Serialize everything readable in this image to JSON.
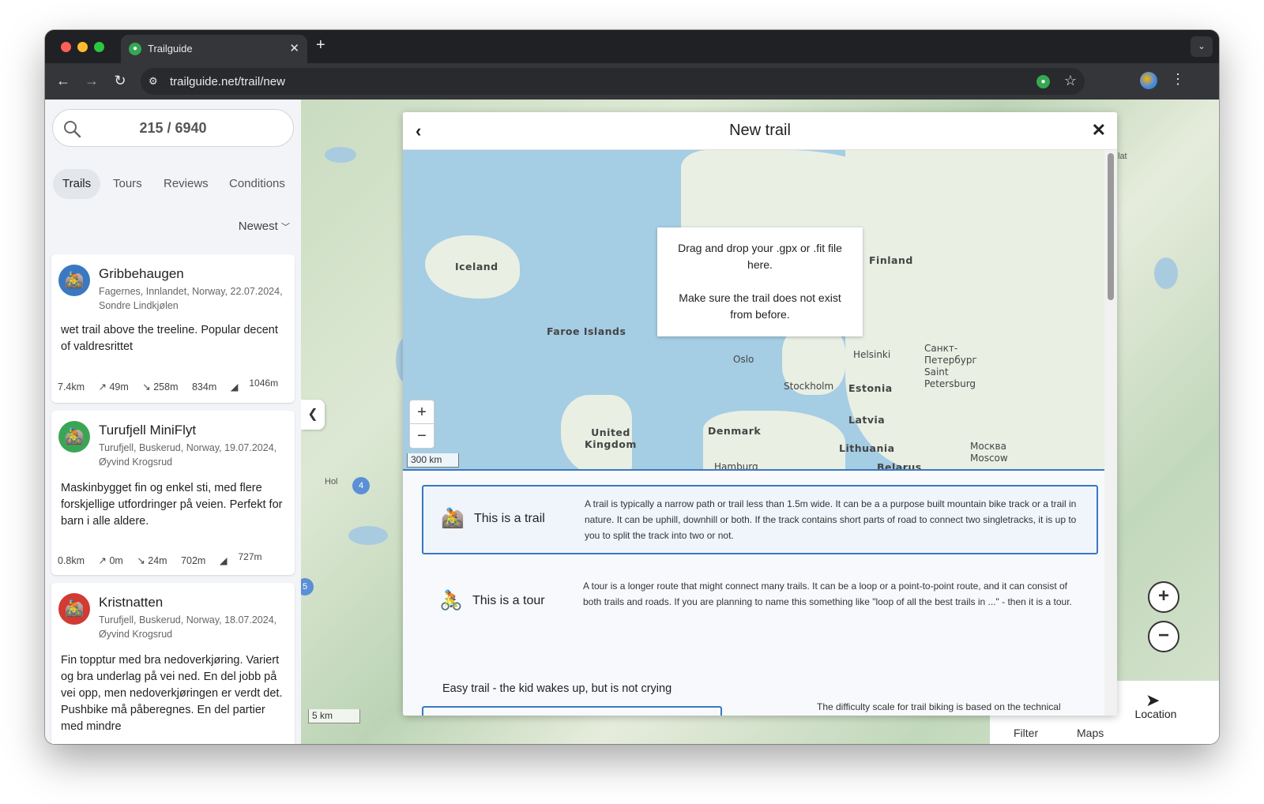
{
  "browser": {
    "tab_title": "Trailguide",
    "tab_close": "✕",
    "new_tab": "+",
    "url": "trailguide.net/trail/new"
  },
  "sidebar": {
    "search_count": "215 / 6940",
    "tabs": [
      {
        "label": "Trails",
        "active": true
      },
      {
        "label": "Tours",
        "active": false
      },
      {
        "label": "Reviews",
        "active": false
      },
      {
        "label": "Conditions",
        "active": false
      }
    ],
    "sort_label": "Newest",
    "cards": [
      {
        "title": "Gribbehaugen",
        "meta": "Fagernes, Innlandet, Norway, 22.07.2024, Sondre Lindkjølen",
        "desc": "wet trail above the treeline. Popular decent of valdresrittet",
        "distance": "7.4km",
        "climb": "↗ 49m",
        "descent": "↘ 258m",
        "min_alt": "834m",
        "max_alt": "1046m",
        "avatar_color": "#3a78c2"
      },
      {
        "title": "Turufjell MiniFlyt",
        "meta": "Turufjell, Buskerud, Norway, 19.07.2024, Øyvind Krogsrud",
        "desc": "Maskinbygget fin og enkel sti, med flere forskjellige utfordringer på veien. Perfekt for barn i alle aldere.",
        "distance": "0.8km",
        "climb": "↗ 0m",
        "descent": "↘ 24m",
        "min_alt": "702m",
        "max_alt": "727m",
        "avatar_color": "#3aa655"
      },
      {
        "title": "Kristnatten",
        "meta": "Turufjell, Buskerud, Norway, 18.07.2024, Øyvind Krogsrud",
        "desc": "Fin topptur med bra nedoverkjøring. Variert og bra underlag på vei ned. En del jobb på vei opp, men nedoverkjøringen er verdt det. Pushbike må påberegnes. En del partier med mindre",
        "avatar_color": "#d23a32"
      }
    ]
  },
  "map": {
    "scale": "5 km",
    "clusters": [
      "4",
      "5"
    ],
    "place_hol": "Hol",
    "place_lat": "lat",
    "bottom_filter": "Filter",
    "bottom_maps": "Maps",
    "location_label": "Location"
  },
  "modal": {
    "title": "New trail",
    "drop_line1": "Drag and drop your .gpx or .fit file here.",
    "drop_line2": "Make sure the trail does not exist from before.",
    "mini_scale": "300 km",
    "places": {
      "iceland": "Iceland",
      "faroe": "Faroe Islands",
      "finland": "Finland",
      "helsinki": "Helsinki",
      "oslo": "Oslo",
      "stockholm": "Stockholm",
      "estonia": "Estonia",
      "latvia": "Latvia",
      "lithuania": "Lithuania",
      "belarus": "Belarus",
      "denmark": "Denmark",
      "uk": "United Kingdom",
      "hamburg": "Hamburg",
      "stpete": "Санкт-Петербург Saint Petersburg",
      "moscow": "Москва Moscow"
    },
    "options": [
      {
        "label": "This is a trail",
        "desc": "A trail is typically a narrow path or trail less than 1.5m wide. It can be a a purpose built mountain bike track or a trail in nature. It can be uphill, downhill or both. If the track contains short parts of road to connect two singletracks, it is up to you to split the track into two or not.",
        "selected": true
      },
      {
        "label": "This is a tour",
        "desc": "A tour is a longer route that might connect many trails. It can be a loop or a point-to-point route, and it can consist of both trails and roads. If you are planning to name this something like \"loop of all the best trails in ...\" - then it is a tour.",
        "selected": false
      }
    ],
    "difficulty_label": "Easy trail - the kid wakes up, but is not crying",
    "difficulty_note": "The difficulty scale for trail biking is based on the technical"
  },
  "colors": {
    "accent": "#3a78c2",
    "chrome_dark": "#202124",
    "chrome_toolbar": "#35363a"
  }
}
